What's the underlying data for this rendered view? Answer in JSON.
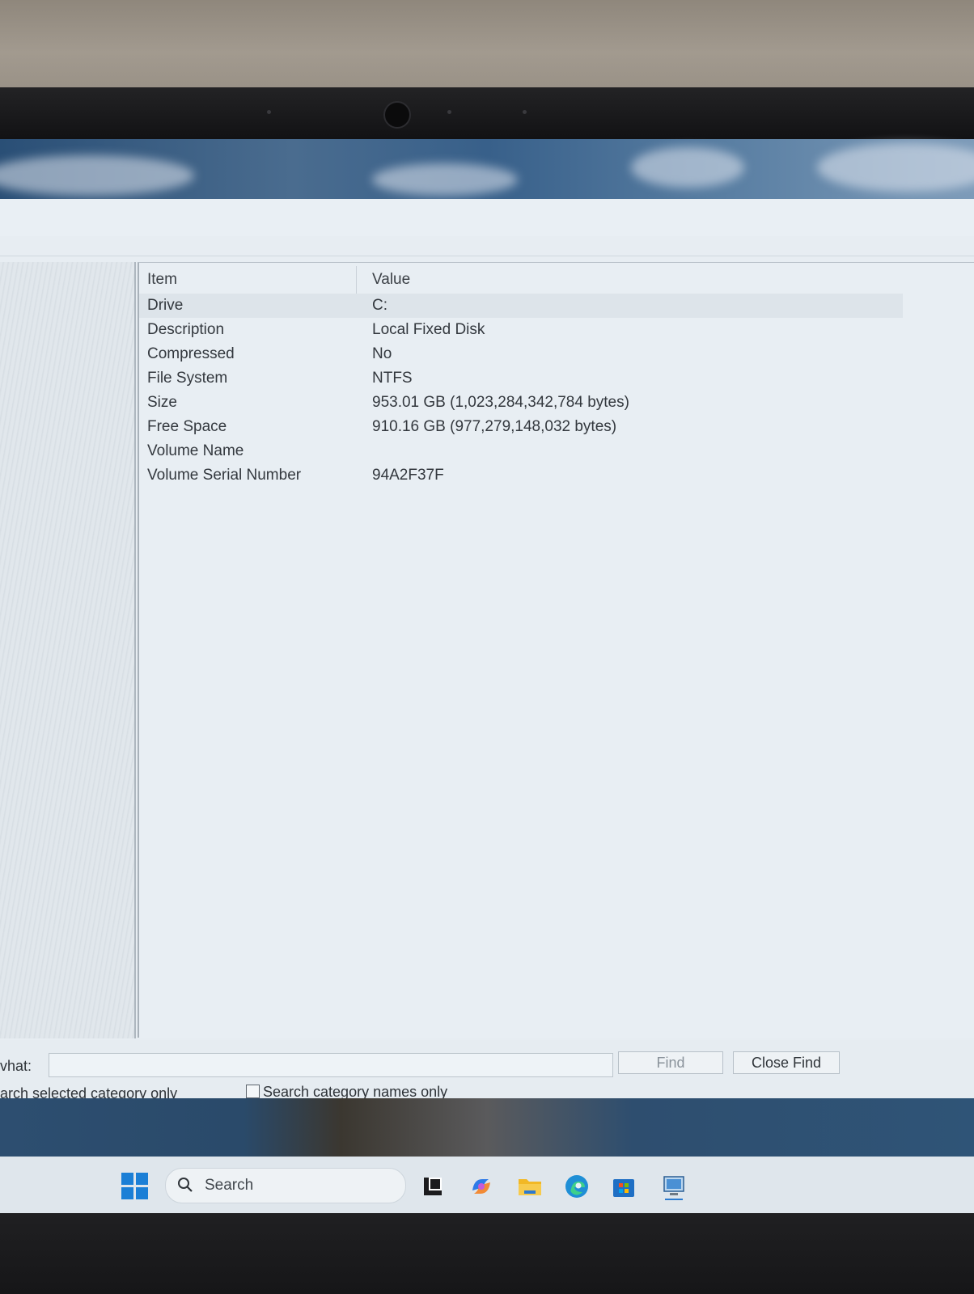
{
  "details": {
    "header_item": "Item",
    "header_value": "Value",
    "rows": [
      {
        "item": "Drive",
        "value": "C:"
      },
      {
        "item": "Description",
        "value": "Local Fixed Disk"
      },
      {
        "item": "Compressed",
        "value": "No"
      },
      {
        "item": "File System",
        "value": "NTFS"
      },
      {
        "item": "Size",
        "value": "953.01 GB (1,023,284,342,784 bytes)"
      },
      {
        "item": "Free Space",
        "value": "910.16 GB (977,279,148,032 bytes)"
      },
      {
        "item": "Volume Name",
        "value": ""
      },
      {
        "item": "Volume Serial Number",
        "value": "94A2F37F"
      }
    ]
  },
  "find": {
    "label": "vhat:",
    "input_value": "",
    "find_button": "Find",
    "close_find_button": "Close Find",
    "search_selected_label": "arch selected category only",
    "search_names_label": "Search category names only"
  },
  "taskbar": {
    "search_placeholder": "Search",
    "icons": [
      "windows-start-icon",
      "task-view-icon",
      "copilot-icon",
      "file-explorer-icon",
      "edge-icon",
      "store-icon",
      "system-information-icon"
    ]
  },
  "colors": {
    "windows_blue": "#1b7fd6",
    "selected_row": "#dde4ea"
  }
}
